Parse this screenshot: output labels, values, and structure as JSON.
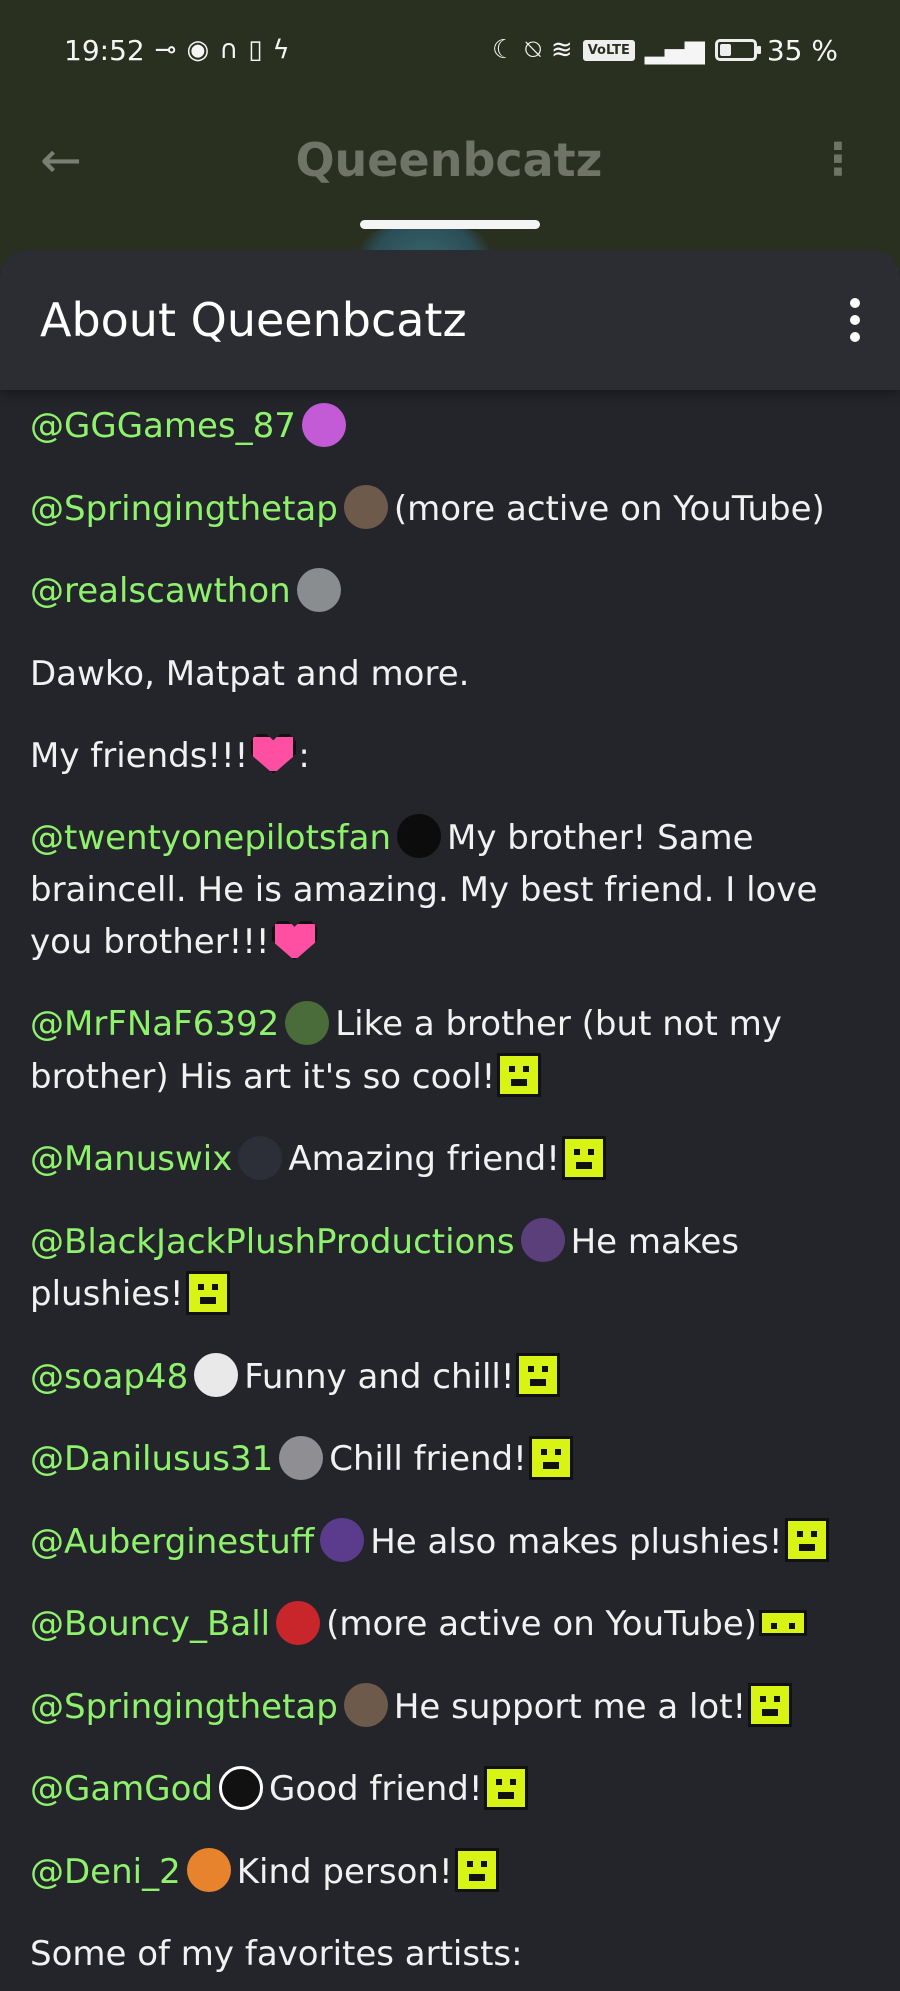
{
  "status_bar": {
    "time": "19:52",
    "left_icons": [
      "key-icon",
      "eye-icon",
      "headphones-icon",
      "battery-small-icon",
      "bolt-icon"
    ],
    "right_icons": [
      "moon-icon",
      "bell-off-icon",
      "wifi-icon",
      "volte-icon",
      "signal-icon",
      "battery-icon"
    ],
    "volte": "VoLTE",
    "battery": "35 %"
  },
  "header": {
    "title": "Queenbcatz",
    "back_icon": "arrow-left-icon",
    "menu_icon": "more-vertical-icon"
  },
  "sheet": {
    "title": "About Queenbcatz",
    "menu_icon": "more-vertical-icon"
  },
  "content": {
    "lines": [
      {
        "mention": "@GGGames_87",
        "avatar": "#c45bd6",
        "text": ""
      },
      {
        "mention": "@Springingthetap",
        "avatar": "#6e5a4a",
        "text": "(more active on YouTube)"
      },
      {
        "mention": "@realscawthon",
        "avatar": "#8a8d8f",
        "text": ""
      },
      {
        "plain": "Dawko, Matpat and more."
      },
      {
        "plain": "My friends!!!",
        "suffix": ":"
      },
      {
        "mention": "@twentyonepilotsfan",
        "avatar": "#0c0c0c",
        "text": "My brother! Same braincell. He is amazing. My best friend. I love you brother!!!"
      },
      {
        "mention": "@MrFNaF6392",
        "avatar": "#4a6b3a",
        "text": "Like a brother (but not my brother) His art it's so cool!"
      },
      {
        "mention": "@Manuswix",
        "avatar": "#2c2f38",
        "text": "Amazing friend!"
      },
      {
        "mention": "@BlackJackPlushProductions",
        "avatar": "#5a3f7a",
        "text": "He makes plushies!"
      },
      {
        "mention": "@soap48",
        "avatar": "#e9e9e9",
        "text": "Funny and chill!"
      },
      {
        "mention": "@Danilusus31",
        "avatar": "#8e8e93",
        "text": "Chill friend!"
      },
      {
        "mention": "@Auberginestuff",
        "avatar": "#5b3c8c",
        "text": "He also makes plushies!"
      },
      {
        "mention": "@Bouncy_Ball",
        "avatar": "#c8262b",
        "text": "(more active on YouTube)"
      },
      {
        "mention": "@Springingthetap",
        "avatar": "#6e5a4a",
        "text": "He support me a lot!"
      },
      {
        "mention": "@GamGod",
        "avatar": "#111111",
        "text": "Good friend!"
      },
      {
        "mention": "@Deni_2",
        "avatar": "#e8832d",
        "text": "Kind person!"
      },
      {
        "plain": "Some of my favorites artists:"
      }
    ]
  },
  "colors": {
    "mention": "#8ff26c",
    "background": "#24252b",
    "sheet_header": "#2c2d33",
    "emoji_green": "#d8f414",
    "heart_pink": "#ff4fa3"
  }
}
